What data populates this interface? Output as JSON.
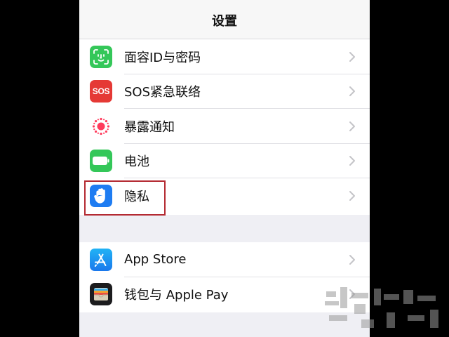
{
  "nav": {
    "title": "设置"
  },
  "settings_group_1": [
    {
      "label": "面容ID与密码",
      "icon": "face-id-icon",
      "icon_color": "#34c759"
    },
    {
      "label": "SOS紧急联络",
      "icon": "sos-icon",
      "icon_text": "SOS",
      "icon_color": "#e53935"
    },
    {
      "label": "暴露通知",
      "icon": "exposure-notification-icon",
      "icon_color": "#ffffff"
    },
    {
      "label": "电池",
      "icon": "battery-icon",
      "icon_color": "#34c759"
    },
    {
      "label": "隐私",
      "icon": "privacy-hand-icon",
      "icon_color": "#1e7cf2"
    }
  ],
  "settings_group_2": [
    {
      "label": "App Store",
      "icon": "app-store-icon",
      "icon_color": "#1e9bf0"
    },
    {
      "label": "钱包与 Apple Pay",
      "icon": "wallet-icon",
      "icon_color": "#1c1c1e"
    }
  ],
  "annotation": {
    "highlighted_item": "隐私",
    "border_color": "#b42a32"
  }
}
